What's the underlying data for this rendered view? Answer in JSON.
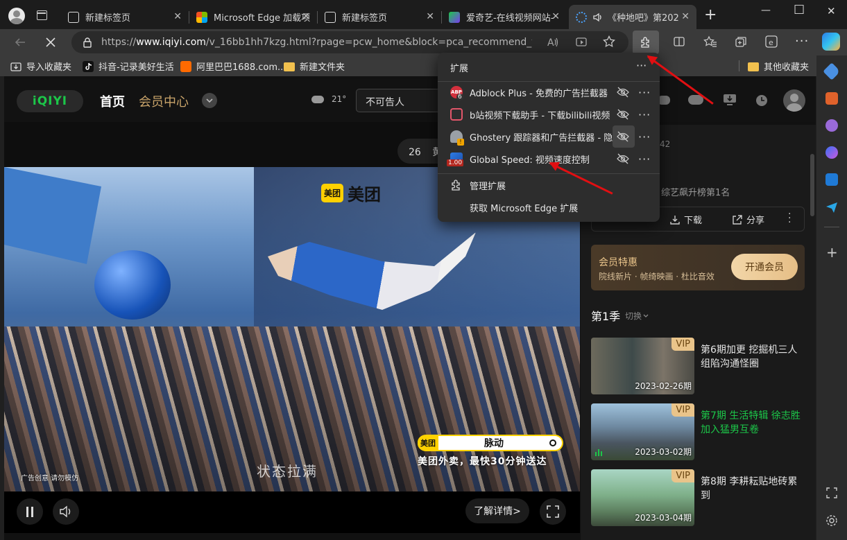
{
  "tabs": [
    {
      "title": "新建标签页",
      "active": false
    },
    {
      "title": "Microsoft Edge 加载项",
      "active": false
    },
    {
      "title": "新建标签页",
      "active": false
    },
    {
      "title": "爱奇艺-在线视频网站-",
      "active": false
    },
    {
      "title": "《种地吧》第202",
      "active": true
    }
  ],
  "window_controls": {
    "minimize": "—",
    "maximize": "□",
    "close": "✕",
    "new_tab": "+"
  },
  "address": {
    "prefix": "https://",
    "host": "www.iqiyi.com",
    "path": "/v_16bb1hh7kzg.html?rpage=pcw_home&block=pca_recommend_tracing&rs..."
  },
  "bookmarks": [
    "导入收藏夹",
    "抖音-记录美好生活",
    "阿里巴巴1688.com...",
    "新建文件夹"
  ],
  "other_bookmarks": "其他收藏夹",
  "iqiyi": {
    "logo": "iQIYI",
    "nav_home": "首页",
    "nav_vip": "会员中心",
    "weather": "21°",
    "search_value": "不可告人"
  },
  "danmaku_num": "26",
  "danmaku_char": "黄",
  "right_count": "42",
  "rank_text": "综艺飙升榜第1名",
  "actions": {
    "download": "下载",
    "share": "分享"
  },
  "vip_promo": {
    "title": "会员特惠",
    "desc": "院线新片 · 帧绮映画 · 杜比音效",
    "button": "开通会员"
  },
  "season": {
    "label": "第1季",
    "switch": "切换"
  },
  "episodes": [
    {
      "vip": "VIP",
      "date": "2023-02-26期",
      "title": "第6期加更 挖掘机三人组陷沟通怪圈",
      "playing": false
    },
    {
      "vip": "VIP",
      "date": "2023-03-02期",
      "title": "第7期 生活特辑 徐志胜加入猛男互卷",
      "playing": true
    },
    {
      "vip": "VIP",
      "date": "2023-03-04期",
      "title": "第8期 李耕耘贴地砖累到",
      "playing": false
    }
  ],
  "video": {
    "ad_label": "广告创意 请勿模仿",
    "brand": "美团",
    "search_text": "脉动",
    "slogan": "美团外卖，最快30分钟送达",
    "subtitle": "状态拉满",
    "learn_more": "了解详情>"
  },
  "extensions_popup": {
    "title": "扩展",
    "items": [
      {
        "name": "Adblock Plus - 免费的广告拦截器",
        "badge": "6"
      },
      {
        "name": "b站视频下载助手 - 下载bilibili视频",
        "badge": ""
      },
      {
        "name": "Ghostery 跟踪器和广告拦截器 - 隐...",
        "badge": "!"
      },
      {
        "name": "Global Speed: 视频速度控制",
        "badge": "1.00"
      }
    ],
    "manage": "管理扩展",
    "get": "获取 Microsoft Edge 扩展"
  },
  "colors": {
    "accent_green": "#1cc749",
    "arrow_red": "#e10f12",
    "vip_gold": "#e9c48a"
  }
}
